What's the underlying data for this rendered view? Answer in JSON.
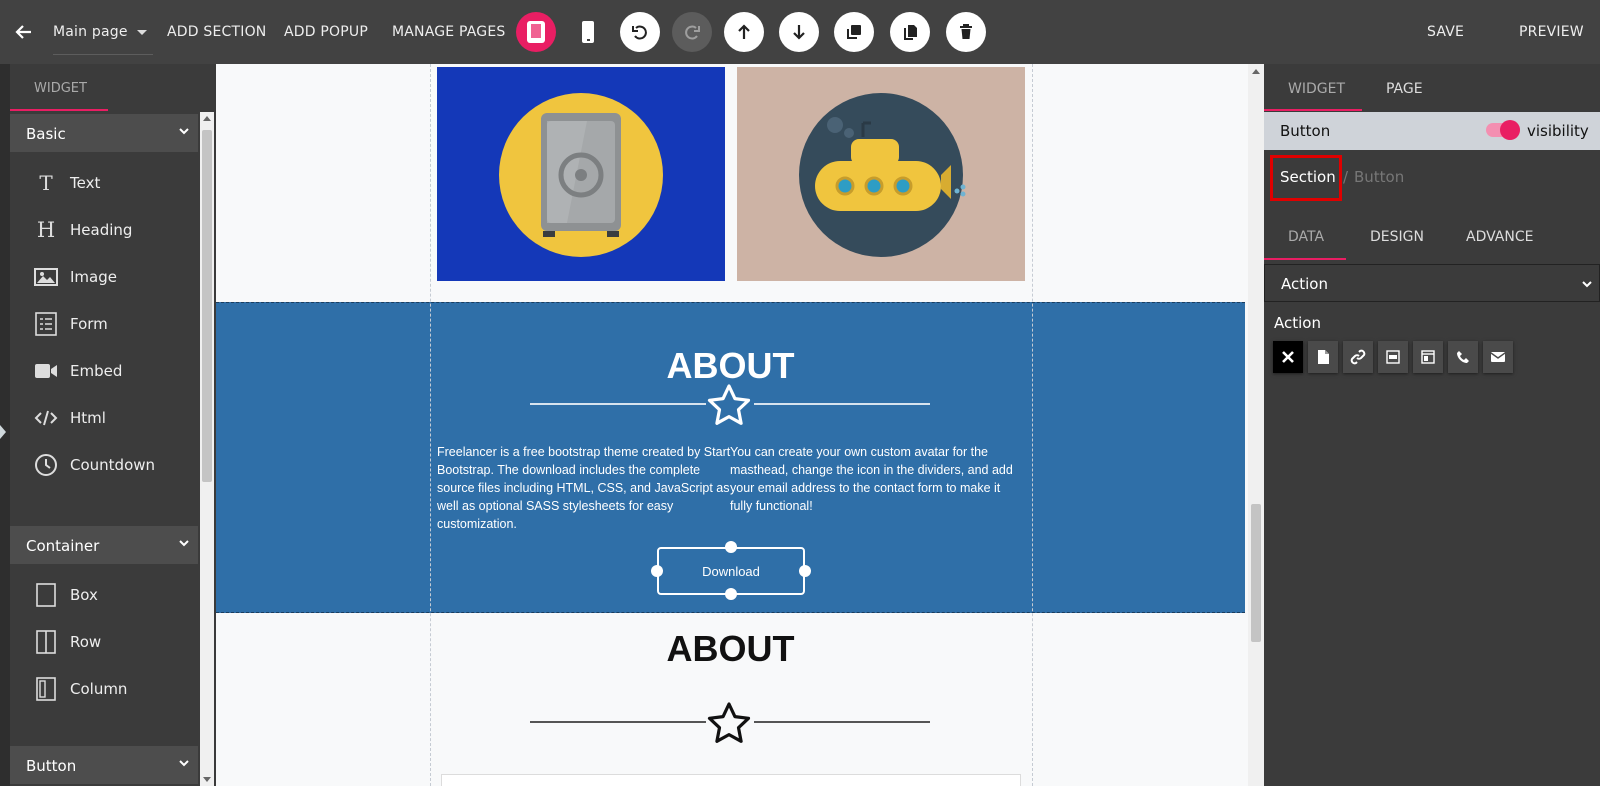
{
  "topbar": {
    "page_select": "Main page",
    "add_section": "ADD SECTION",
    "add_popup": "ADD POPUP",
    "manage_pages": "MANAGE PAGES",
    "save": "SAVE",
    "preview": "PREVIEW"
  },
  "left_panel": {
    "tab": "WIDGET",
    "categories": {
      "basic": "Basic",
      "container": "Container",
      "button": "Button"
    },
    "basic_items": {
      "text": "Text",
      "heading": "Heading",
      "image": "Image",
      "form": "Form",
      "embed": "Embed",
      "html": "Html",
      "countdown": "Countdown"
    },
    "container_items": {
      "box": "Box",
      "row": "Row",
      "column": "Column"
    }
  },
  "canvas": {
    "about_title": "ABOUT",
    "para_left": "Freelancer is a free bootstrap theme created by Start Bootstrap. The download includes the complete source files including HTML, CSS, and JavaScript as well as optional SASS stylesheets for easy customization.",
    "para_right": "You can create your own custom avatar for the masthead, change the icon in the dividers, and add your email address to the contact form to make it fully functional!",
    "download_button": "Download",
    "about_title_2": "ABOUT"
  },
  "right_panel": {
    "tab_widget": "WIDGET",
    "tab_page": "PAGE",
    "element_name": "Button",
    "visibility_label": "visibility",
    "breadcrumb_section": "Section",
    "breadcrumb_sep": "/",
    "breadcrumb_current": "Button",
    "sub_tabs": {
      "data": "DATA",
      "design": "DESIGN",
      "advance": "ADVANCE"
    },
    "action_dropdown": "Action",
    "action_label": "Action"
  },
  "colors": {
    "accent": "#e91e63",
    "about_bg": "#2f6fa8",
    "safe_bg": "#1438b8",
    "sub_bg": "#cdb3a5",
    "highlight_box": "#e00000"
  },
  "icons": {
    "back": "arrow-left-icon",
    "tablet": "tablet-icon",
    "mobile": "mobile-icon",
    "undo": "undo-icon",
    "redo": "redo-icon",
    "move_up": "arrow-up-icon",
    "move_down": "arrow-down-icon",
    "duplicate": "duplicate-icon",
    "copy": "copy-icon",
    "delete": "trash-icon"
  }
}
